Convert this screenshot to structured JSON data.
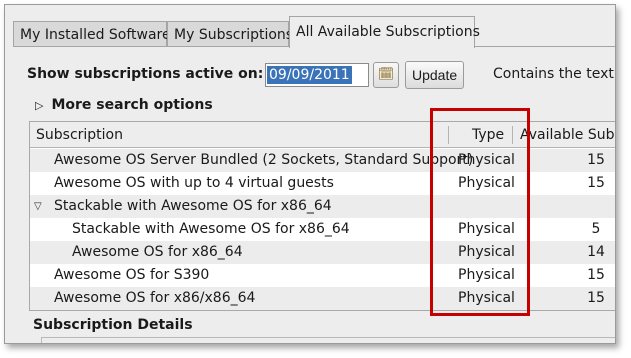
{
  "tabs": [
    {
      "label": "My Installed Software"
    },
    {
      "label": "My Subscriptions"
    },
    {
      "label": "All Available Subscriptions"
    }
  ],
  "filter": {
    "show_label": "Show subscriptions active on:",
    "date_value": "09/09/2011",
    "update_label": "Update",
    "contains_label": "Contains the text:",
    "more_search_label": "More search options"
  },
  "table": {
    "columns": [
      "Subscription",
      "Type",
      "Available Subsc"
    ],
    "rows": [
      {
        "name": "Awesome OS Server Bundled (2 Sockets, Standard Support)",
        "type": "Physical",
        "available": "15"
      },
      {
        "name": "Awesome OS with up to 4 virtual guests",
        "type": "Physical",
        "available": "15"
      },
      {
        "name": "Stackable with Awesome OS for x86_64",
        "type": "",
        "available": ""
      },
      {
        "name": "Stackable with Awesome OS for x86_64",
        "type": "Physical",
        "available": "5"
      },
      {
        "name": "Awesome OS for x86_64",
        "type": "Physical",
        "available": "14"
      },
      {
        "name": "Awesome OS for S390",
        "type": "Physical",
        "available": "15"
      },
      {
        "name": "Awesome OS for x86/x86_64",
        "type": "Physical",
        "available": "15"
      }
    ]
  },
  "details": {
    "label": "Subscription Details"
  },
  "icons": {
    "calendar": "calendar-icon",
    "expander_collapsed": "triangle-right-icon",
    "expander_expanded": "triangle-down-icon"
  },
  "colors": {
    "highlight": "#c40000",
    "selection": "#3a73b8"
  }
}
